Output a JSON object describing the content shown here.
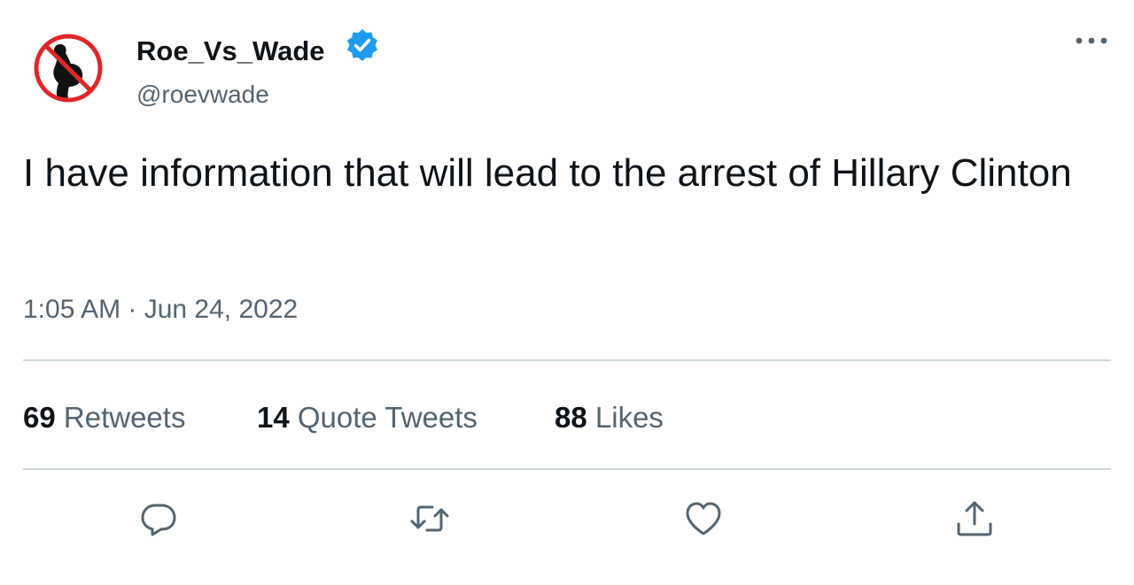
{
  "user": {
    "display_name": "Roe_Vs_Wade",
    "handle": "@roevwade",
    "verified": true
  },
  "tweet": {
    "text": "I have information that will lead to the arrest of Hillary Clinton",
    "timestamp": "1:05 AM · Jun 24, 2022"
  },
  "stats": {
    "retweets": {
      "count": "69",
      "label": "Retweets"
    },
    "quote_tweets": {
      "count": "14",
      "label": "Quote Tweets"
    },
    "likes": {
      "count": "88",
      "label": "Likes"
    }
  },
  "actions": [
    "reply-icon",
    "retweet-icon",
    "like-icon",
    "share-icon"
  ],
  "colors": {
    "text_primary": "#0f1419",
    "text_secondary": "#536471",
    "verified_blue": "#1d9bf0",
    "divider": "#cfd9de",
    "avatar_ring": "#e0262a"
  }
}
